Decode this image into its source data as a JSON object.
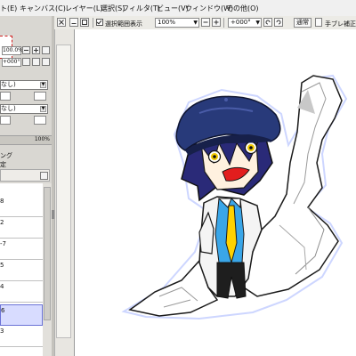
{
  "menubar": {
    "items": [
      {
        "label": "ト(E)"
      },
      {
        "label": "キャンバス(C)"
      },
      {
        "label": "レイヤー(L)"
      },
      {
        "label": "選択(S)"
      },
      {
        "label": "フィルタ(T)"
      },
      {
        "label": "ビュー(V)"
      },
      {
        "label": "ウィンドウ(W)"
      },
      {
        "label": "その他(O)"
      }
    ]
  },
  "toolbar": {
    "selection_checkbox_label": "選択範囲表示",
    "selection_checked": true,
    "zoom_value": "100%",
    "rotation_value": "+000°",
    "normal_button_label": "通常",
    "stabilizer_label": "手ブレ補正"
  },
  "side_panel": {
    "zoom_field": "100.0%",
    "angle_field": "+000°",
    "combo1": "なし)",
    "combo2": "なし)",
    "opacity_value": "100%",
    "mode_line1": "ング",
    "mode_line2": "定",
    "layers": [
      {
        "label": "8"
      },
      {
        "label": "2"
      },
      {
        "label": "-7"
      },
      {
        "label": "5"
      },
      {
        "label": "4"
      },
      {
        "label": "6"
      },
      {
        "label": "3"
      }
    ],
    "selected_layer_index": 5
  }
}
